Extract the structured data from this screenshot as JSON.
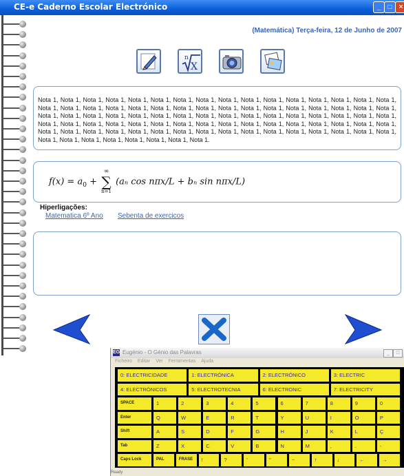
{
  "window": {
    "title": "CE-e  Caderno Escolar Electrónico",
    "date": "(Matemática) Terça-feira, 12 de Junho de 2007"
  },
  "toolbar": [
    {
      "name": "edit-tool-button",
      "icon": "pencil-note-icon"
    },
    {
      "name": "math-tool-button",
      "icon": "nth-root-icon",
      "glyph": "ⁿ√X"
    },
    {
      "name": "camera-tool-button",
      "icon": "camera-icon"
    },
    {
      "name": "images-tool-button",
      "icon": "pictures-icon"
    }
  ],
  "notes": {
    "text": "Nota 1, Nota 1, Nota 1, Nota 1, Nota 1, Nota 1, Nota 1, Nota 1, Nota 1, Nota 1, Nota 1, Nota 1, Nota 1, Nota 1, Nota 1, Nota 1, Nota 1, Nota 1, Nota 1, Nota 1, Nota 1, Nota 1, Nota 1, Nota 1, Nota 1, Nota 1, Nota 1, Nota 1, Nota 1, Nota 1, Nota 1, Nota 1, Nota 1, Nota 1, Nota 1, Nota 1, Nota 1, Nota 1, Nota 1, Nota 1, Nota 1, Nota 1, Nota 1, Nota 1, Nota 1, Nota 1, Nota 1, Nota 1, Nota 1, Nota 1, Nota 1, Nota 1, Nota 1, Nota 1, Nota 1, Nota 1, Nota 1, Nota 1, Nota 1, Nota 1, Nota 1, Nota 1, Nota 1, Nota 1, Nota 1, Nota 1, Nota 1, Nota 1, Nota 1, Nota 1, Nota 1, Nota 1, Nota 1, Nota 1, Nota 1, Nota 1, Nota 1, Nota 1, Nota 1, Nota 1, Nota 1, Nota 1, Nota 1, Nota 1, Nota 1, Nota 1, Nota 1, Nota 1."
  },
  "formula": {
    "lhs": "f(x) = a",
    "sub0": "0",
    "plus": " + ",
    "sum_top": "∞",
    "sum_bottom": "n=1",
    "body": "(aₙ cos nπx/L + bₙ sin nπx/L)"
  },
  "links": {
    "title": "Hiperligações:",
    "items": [
      "Matematica 6º Ano",
      "Sebenta de exercicos"
    ]
  },
  "keyboard": {
    "title": "Eugénio - O Génio das Palavras",
    "icon_label": "EG",
    "menu": [
      "Ficheiro",
      "Editar",
      "Ver",
      "Ferramentas",
      "Ajuda"
    ],
    "rows": [
      [
        "0: ELECTRICIDADE",
        "1: ELECTRÓNICA",
        "2: ELECTRÓNICO",
        "3: ELECTRIC"
      ],
      [
        "4: ELECTRÓNICOS",
        "5: ELECTROTECNIA",
        "6: ELECTRONIC",
        "7: ELECTRICITY"
      ],
      [
        "SPACE",
        "1",
        "2",
        "3",
        "4",
        "5",
        "6",
        "7",
        "8",
        "9",
        "0"
      ],
      [
        "Enter",
        "Q",
        "W",
        "E",
        "R",
        "T",
        "Y",
        "U",
        "I",
        "O",
        "P"
      ],
      [
        "Shift",
        "A",
        "S",
        "D",
        "F",
        "G",
        "H",
        "J",
        "K",
        "L",
        "Ç"
      ],
      [
        "Tab",
        "Z",
        "X",
        "C",
        "V",
        "B",
        "N",
        "M",
        ",",
        ".",
        "-"
      ],
      [
        "Caps Lock",
        "PAL",
        "FRASE",
        "!",
        "?",
        "'",
        "\"",
        "~",
        "↑",
        "↓",
        "←",
        "→"
      ]
    ],
    "status": "Ready"
  }
}
